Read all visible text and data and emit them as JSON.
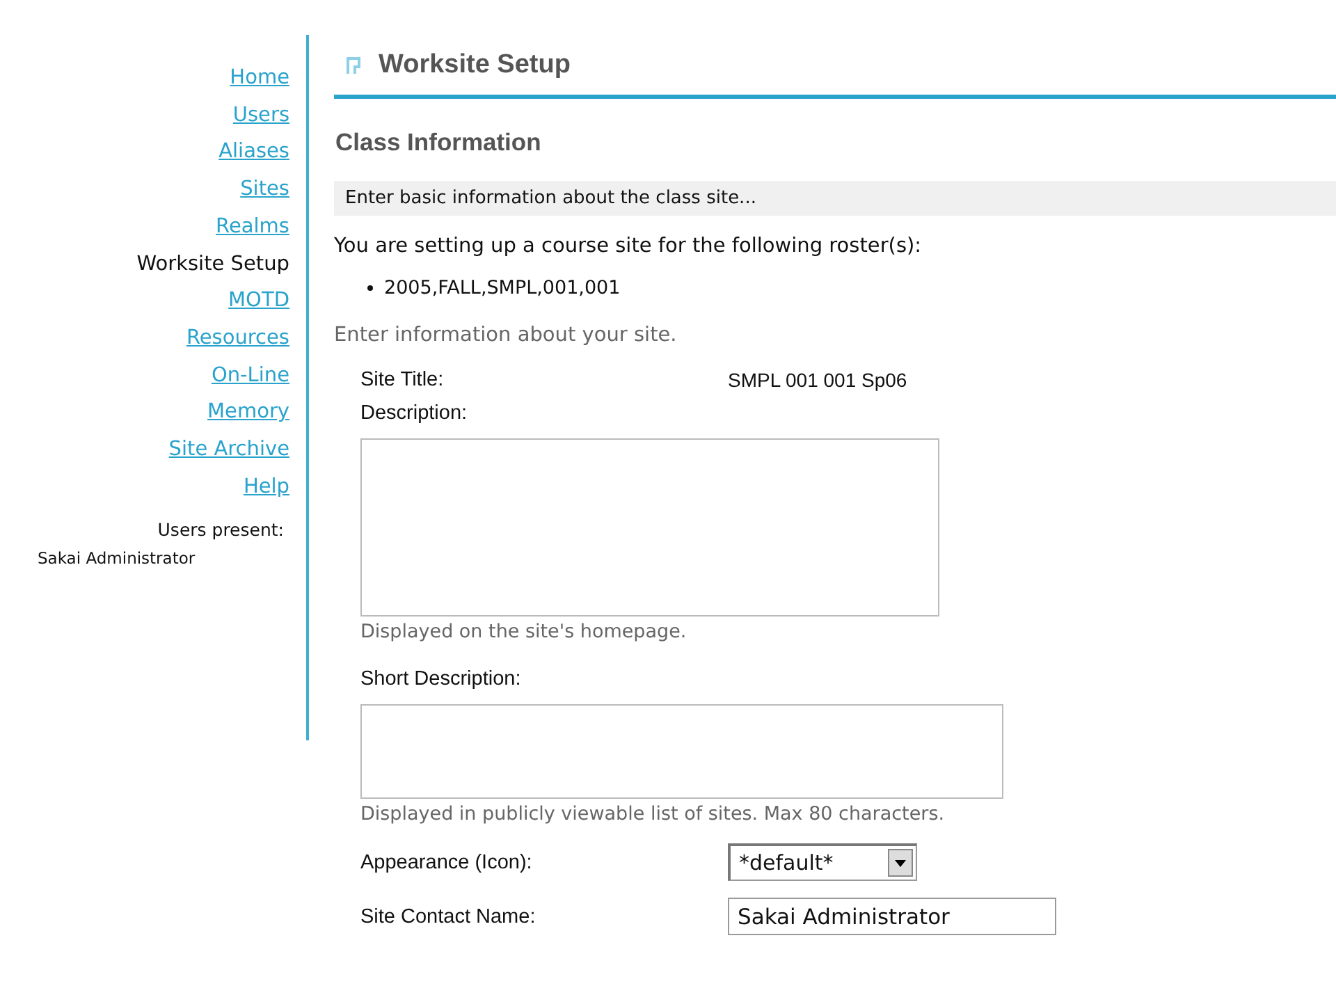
{
  "nav": {
    "items": [
      {
        "label": "Home",
        "selected": false
      },
      {
        "label": "Users",
        "selected": false
      },
      {
        "label": "Aliases",
        "selected": false
      },
      {
        "label": "Sites",
        "selected": false
      },
      {
        "label": "Realms",
        "selected": false
      },
      {
        "label": "Worksite Setup",
        "selected": true
      },
      {
        "label": "MOTD",
        "selected": false
      },
      {
        "label": "Resources",
        "selected": false
      },
      {
        "label": "On-Line",
        "selected": false
      },
      {
        "label": "Memory",
        "selected": false
      },
      {
        "label": "Site Archive",
        "selected": false
      },
      {
        "label": "Help",
        "selected": false
      }
    ],
    "users_present": {
      "label": "Users present:",
      "users": [
        "Sakai Administrator"
      ]
    }
  },
  "tool": {
    "title": "Worksite Setup"
  },
  "page": {
    "heading": "Class Information",
    "instruction": "Enter basic information about the class site...",
    "roster_intro": "You are setting up a course site for the following roster(s):",
    "rosters": [
      "2005,FALL,SMPL,001,001"
    ],
    "site_intro": "Enter information about your site."
  },
  "form": {
    "fields": [
      {
        "kind": "static",
        "label": "Site Title:",
        "value": "SMPL 001 001 Sp06"
      },
      {
        "kind": "long_text",
        "label": "Description:",
        "hint": "Displayed on the site's homepage."
      },
      {
        "kind": "short_text",
        "label": "Short Description:",
        "hint": "Displayed in publicly viewable list of sites. Max 80 characters."
      },
      {
        "kind": "select",
        "label": "Appearance (Icon):",
        "value": "*default*"
      },
      {
        "kind": "text",
        "label": "Site Contact Name:",
        "value": "Sakai Administrator"
      }
    ]
  }
}
